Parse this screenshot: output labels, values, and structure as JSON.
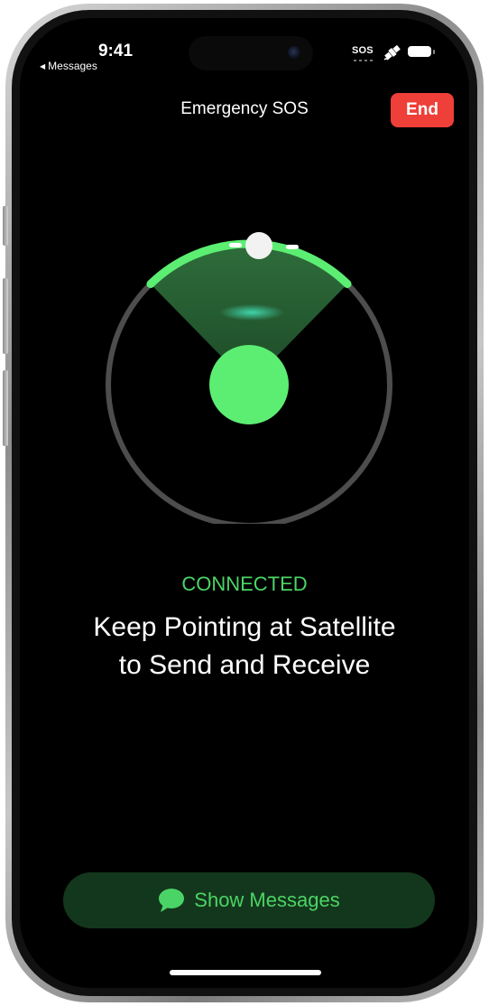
{
  "status_bar": {
    "time": "9:41",
    "back_app": "Messages",
    "back_icon": "back-triangle-icon",
    "sos": "SOS",
    "satellite_icon": "satellite-icon",
    "battery_icon": "battery-icon"
  },
  "header": {
    "title": "Emergency SOS",
    "end_label": "End"
  },
  "satellite_view": {
    "icon": "satellite-pointer",
    "accent": "#4bd466"
  },
  "status": {
    "label": "CONNECTED",
    "headline_line1": "Keep Pointing at Satellite",
    "headline_line2": "to Send and Receive"
  },
  "footer": {
    "show_messages_label": "Show Messages",
    "icon": "message-bubble-icon"
  },
  "colors": {
    "accent_green": "#4bd466",
    "end_red": "#ee3f38",
    "button_bg": "#13371c",
    "background": "#000000"
  }
}
